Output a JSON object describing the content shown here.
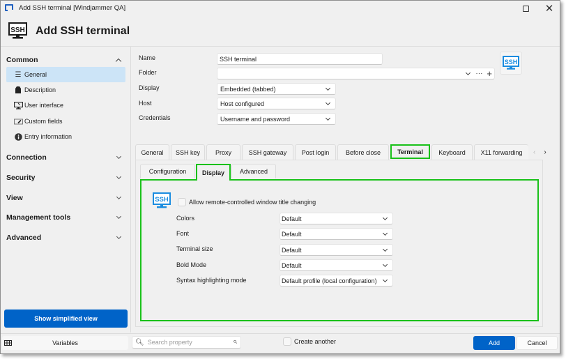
{
  "window": {
    "title": "Add SSH terminal [Windjammer QA]",
    "maximize_icon": "maximize-icon",
    "close_icon": "close-icon"
  },
  "header": {
    "title": "Add SSH terminal",
    "icon": "ssh-monitor-icon",
    "icon_text": "SSH"
  },
  "sidebar": {
    "groups": [
      {
        "label": "Common",
        "expanded": true
      },
      {
        "label": "Connection",
        "expanded": false
      },
      {
        "label": "Security",
        "expanded": false
      },
      {
        "label": "View",
        "expanded": false
      },
      {
        "label": "Management tools",
        "expanded": false
      },
      {
        "label": "Advanced",
        "expanded": false
      }
    ],
    "items": [
      {
        "label": "General",
        "icon": "list-icon",
        "active": true
      },
      {
        "label": "Description",
        "icon": "tag-icon",
        "active": false
      },
      {
        "label": "User interface",
        "icon": "monitor-icon",
        "active": false
      },
      {
        "label": "Custom fields",
        "icon": "edit-field-icon",
        "active": false
      },
      {
        "label": "Entry information",
        "icon": "info-icon",
        "active": false
      }
    ],
    "simplified_button": "Show simplified view"
  },
  "form": {
    "name_label": "Name",
    "name_value": "SSH terminal",
    "folder_label": "Folder",
    "folder_value": "",
    "folder_more": "···",
    "folder_add": "+",
    "display_label": "Display",
    "display_value": "Embedded (tabbed)",
    "host_label": "Host",
    "host_value": "Host configured",
    "credentials_label": "Credentials",
    "credentials_value": "Username and password",
    "entry_icon_text": "SSH"
  },
  "tabs": {
    "items": [
      "General",
      "SSH key",
      "Proxy",
      "SSH gateway",
      "Post login",
      "Before close",
      "Terminal",
      "Keyboard",
      "X11 forwarding"
    ],
    "active": "Terminal",
    "prev_arrow": "‹",
    "next_arrow": "›"
  },
  "subtabs": {
    "items": [
      "Configuration",
      "Display",
      "Advanced"
    ],
    "active": "Display"
  },
  "display": {
    "icon_text": "SSH",
    "allow_title_change_label": "Allow remote-controlled window title changing",
    "allow_title_change_checked": false,
    "fields": [
      {
        "label": "Colors",
        "value": "Default"
      },
      {
        "label": "Font",
        "value": "Default"
      },
      {
        "label": "Terminal size",
        "value": "Default"
      },
      {
        "label": "Bold Mode",
        "value": "Default"
      },
      {
        "label": "Syntax highlighting mode",
        "value": "Default profile (local configuration)"
      }
    ]
  },
  "footer": {
    "variables_label": "Variables",
    "search_placeholder": "Search property",
    "create_another_label": "Create another",
    "create_another_checked": false,
    "add_label": "Add",
    "cancel_label": "Cancel"
  },
  "colors": {
    "accent_blue": "#0063c8",
    "highlight_green": "#19c119",
    "selected_bg": "#cce4f7",
    "ssh_icon_blue": "#1a8ce0"
  }
}
